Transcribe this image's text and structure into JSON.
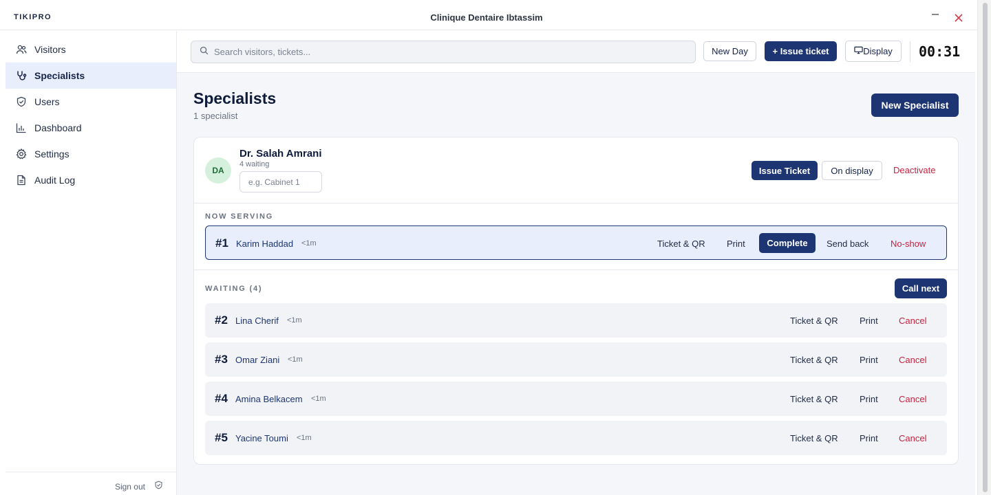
{
  "app": {
    "brand": "TIKIPRO",
    "window_title": "Clinique Dentaire Ibtassim"
  },
  "sidebar": {
    "items": [
      {
        "label": "Visitors",
        "icon": "users-icon",
        "active": false
      },
      {
        "label": "Specialists",
        "icon": "stethoscope-icon",
        "active": true
      },
      {
        "label": "Users",
        "icon": "shield-check-icon",
        "active": false
      },
      {
        "label": "Dashboard",
        "icon": "bar-chart-icon",
        "active": false
      },
      {
        "label": "Settings",
        "icon": "gear-icon",
        "active": false
      },
      {
        "label": "Audit Log",
        "icon": "document-icon",
        "active": false
      }
    ],
    "signout_label": "Sign out"
  },
  "toolbar": {
    "search_placeholder": "Search visitors, tickets...",
    "new_day_label": "New Day",
    "issue_ticket_label": "+ Issue ticket",
    "display_label": "Display",
    "clock": "00:31"
  },
  "page": {
    "title": "Specialists",
    "subtitle": "1 specialist",
    "new_specialist_label": "New Specialist"
  },
  "specialist": {
    "initials": "DA",
    "name": "Dr. Salah Amrani",
    "waiting_text": "4 waiting",
    "cabinet_placeholder": "e.g. Cabinet 1",
    "issue_ticket_label": "Issue Ticket",
    "on_display_label": "On display",
    "deactivate_label": "Deactivate"
  },
  "now_serving": {
    "label": "NOW SERVING",
    "ticket": {
      "number": "#1",
      "name": "Karim Haddad",
      "time": "<1m"
    },
    "actions": {
      "ticket_qr": "Ticket & QR",
      "print": "Print",
      "complete": "Complete",
      "send_back": "Send back",
      "no_show": "No-show"
    }
  },
  "waiting": {
    "label": "WAITING (4)",
    "call_next_label": "Call next",
    "actions": {
      "ticket_qr": "Ticket & QR",
      "print": "Print",
      "cancel": "Cancel"
    },
    "tickets": [
      {
        "number": "#2",
        "name": "Lina Cherif",
        "time": "<1m"
      },
      {
        "number": "#3",
        "name": "Omar Ziani",
        "time": "<1m"
      },
      {
        "number": "#4",
        "name": "Amina Belkacem",
        "time": "<1m"
      },
      {
        "number": "#5",
        "name": "Yacine Toumi",
        "time": "<1m"
      }
    ]
  },
  "colors": {
    "primary": "#1d3573",
    "danger": "#c8213f",
    "active_bg": "#e8eefb",
    "avatar_bg": "#d5f0dc"
  }
}
